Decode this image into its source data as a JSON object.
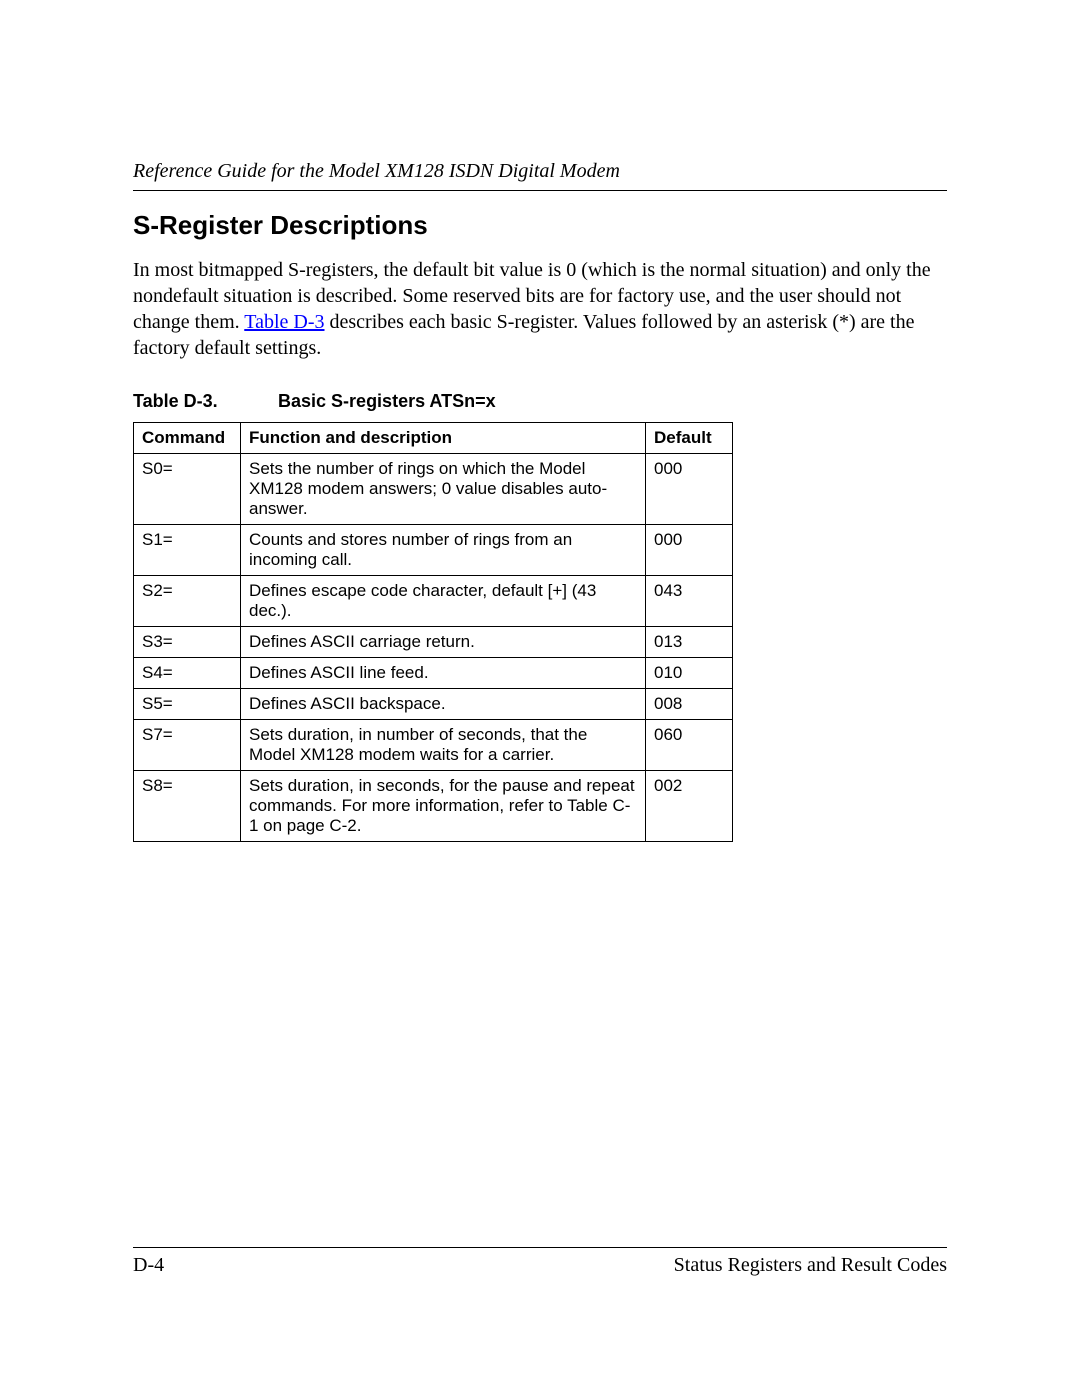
{
  "header": {
    "running_title": "Reference Guide for the Model XM128 ISDN Digital Modem"
  },
  "section": {
    "heading": "S-Register Descriptions",
    "intro_before_link": "In most bitmapped S-registers, the default bit value is 0 (which is the normal situation) and only the nondefault situation is described. Some reserved bits are for factory use, and the user should not change them. ",
    "intro_link_text": "Table D-3",
    "intro_after_link": " describes each basic S-register. Values followed by an asterisk (*) are the factory default settings."
  },
  "table": {
    "caption_number": "Table D-3.",
    "caption_title": "Basic S-registers ATSn=x",
    "headers": {
      "command": "Command",
      "function": "Function and description",
      "default": "Default"
    },
    "rows": [
      {
        "command": "S0=",
        "function": "Sets the number of rings on which the Model XM128 modem answers; 0 value disables auto-answer.",
        "default": "000"
      },
      {
        "command": "S1=",
        "function": "Counts and stores number of rings from an incoming call.",
        "default": "000"
      },
      {
        "command": "S2=",
        "function": "Defines escape code character, default [+] (43 dec.).",
        "default": "043"
      },
      {
        "command": "S3=",
        "function": "Defines ASCII carriage return.",
        "default": "013"
      },
      {
        "command": "S4=",
        "function": "Defines ASCII line feed.",
        "default": "010"
      },
      {
        "command": "S5=",
        "function": "Defines ASCII backspace.",
        "default": "008"
      },
      {
        "command": "S7=",
        "function": "Sets duration, in number of seconds, that the Model XM128 modem waits for a carrier.",
        "default": "060"
      },
      {
        "command": "S8=",
        "function": "Sets duration, in seconds, for the pause and repeat commands. For more information, refer to Table C-1 on page C-2.",
        "default": "002"
      }
    ]
  },
  "footer": {
    "page_number": "D-4",
    "section_name": "Status Registers and Result Codes"
  }
}
